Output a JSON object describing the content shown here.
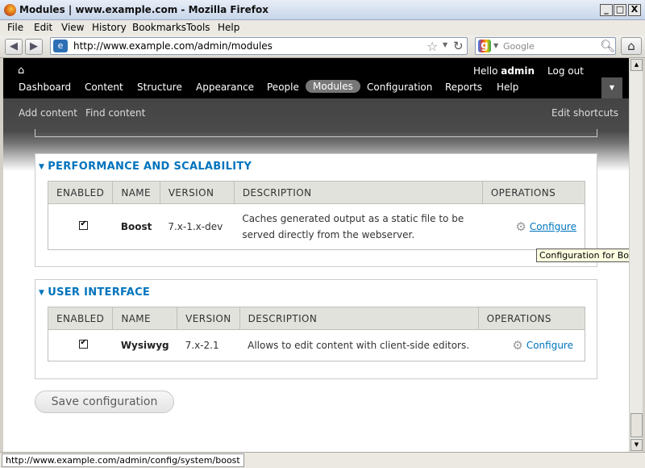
{
  "window": {
    "title": "Modules | www.example.com - Mozilla Firefox",
    "min": "_",
    "max": "□",
    "close": "X"
  },
  "menubar": [
    "File",
    "Edit",
    "View",
    "History",
    "Bookmarks",
    "Tools",
    "Help"
  ],
  "navbar": {
    "url": "http://www.example.com/admin/modules",
    "search_placeholder": "Google"
  },
  "admin_toolbar": {
    "hello_prefix": "Hello ",
    "user": "admin",
    "logout": "Log out",
    "menu": [
      "Dashboard",
      "Content",
      "Structure",
      "Appearance",
      "People",
      "Modules",
      "Configuration",
      "Reports",
      "Help"
    ],
    "active_menu": "Modules",
    "shortcuts": [
      "Add content",
      "Find content"
    ],
    "edit_shortcuts": "Edit shortcuts"
  },
  "sections": [
    {
      "legend": "PERFORMANCE AND SCALABILITY",
      "headers": [
        "ENABLED",
        "NAME",
        "VERSION",
        "DESCRIPTION",
        "OPERATIONS"
      ],
      "row": {
        "enabled": true,
        "name": "Boost",
        "version": "7.x-1.x-dev",
        "description_line1": "Caches generated output as a static file to be",
        "description_line2": "served directly from the webserver.",
        "operation": "Configure"
      }
    },
    {
      "legend": "USER INTERFACE",
      "headers": [
        "ENABLED",
        "NAME",
        "VERSION",
        "DESCRIPTION",
        "OPERATIONS"
      ],
      "row": {
        "enabled": true,
        "name": "Wysiwyg",
        "version": "7.x-2.1",
        "description_line1": "Allows to edit content with client-side editors.",
        "operation": "Configure"
      }
    }
  ],
  "tooltip": "Configuration for Boost.",
  "save_button": "Save configuration",
  "status_url": "http://www.example.com/admin/config/system/boost",
  "colors": {
    "link": "#0074bd",
    "toolbar": "#000000",
    "header_bg": "#e1e2dc"
  }
}
